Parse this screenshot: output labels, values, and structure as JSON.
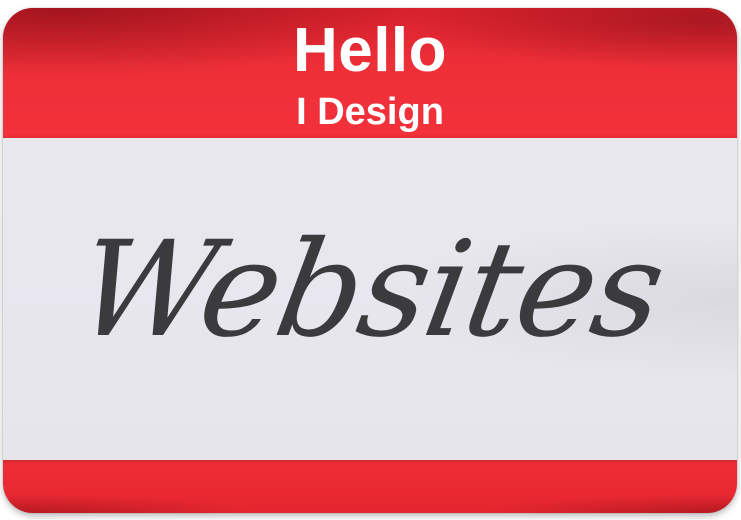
{
  "name_tag": {
    "greeting": "Hello",
    "subtitle": "I Design",
    "name": "Websites"
  },
  "colors": {
    "band_red": "#ee2f38",
    "panel_gray": "#e8e7ee",
    "text_white": "#ffffff",
    "script_dark": "#3b3b3d"
  }
}
